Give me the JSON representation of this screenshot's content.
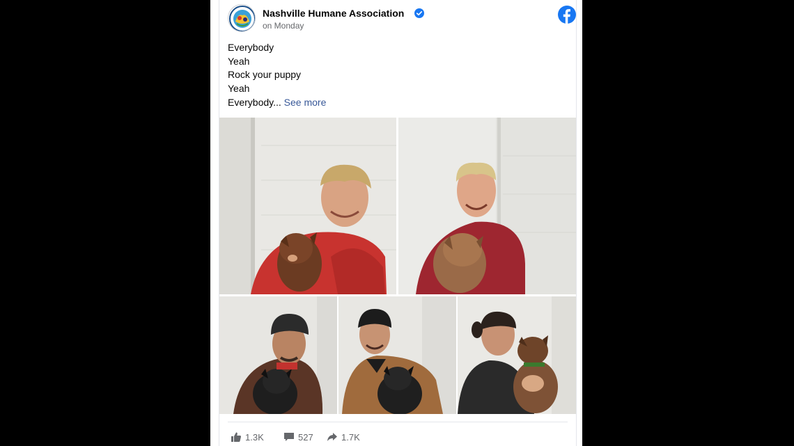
{
  "post": {
    "page_name": "Nashville Humane Association",
    "time": "on Monday",
    "text_lines": [
      "Everybody",
      "Yeah",
      "Rock your puppy",
      "Yeah",
      "Everybody..."
    ],
    "see_more": "See more"
  },
  "photos": [
    {
      "subject": "man with blond hair in red jacket holding brown puppy"
    },
    {
      "subject": "man with blond hair in red blazer holding brown puppy"
    },
    {
      "subject": "man in black beanie and brown jacket holding black puppy"
    },
    {
      "subject": "man in brown jacket holding black puppy"
    },
    {
      "subject": "man with ponytail kissing brown puppy"
    }
  ],
  "footer": {
    "likes": "1.3K",
    "comments": "527",
    "shares": "1.7K"
  },
  "colors": {
    "facebook_blue": "#1877f2",
    "link": "#385898",
    "muted": "#65676b"
  },
  "icons": {
    "verified": "verified-badge-icon",
    "facebook": "facebook-logo-icon",
    "like": "thumbs-up-icon",
    "comment": "comment-icon",
    "share": "share-arrow-icon"
  }
}
